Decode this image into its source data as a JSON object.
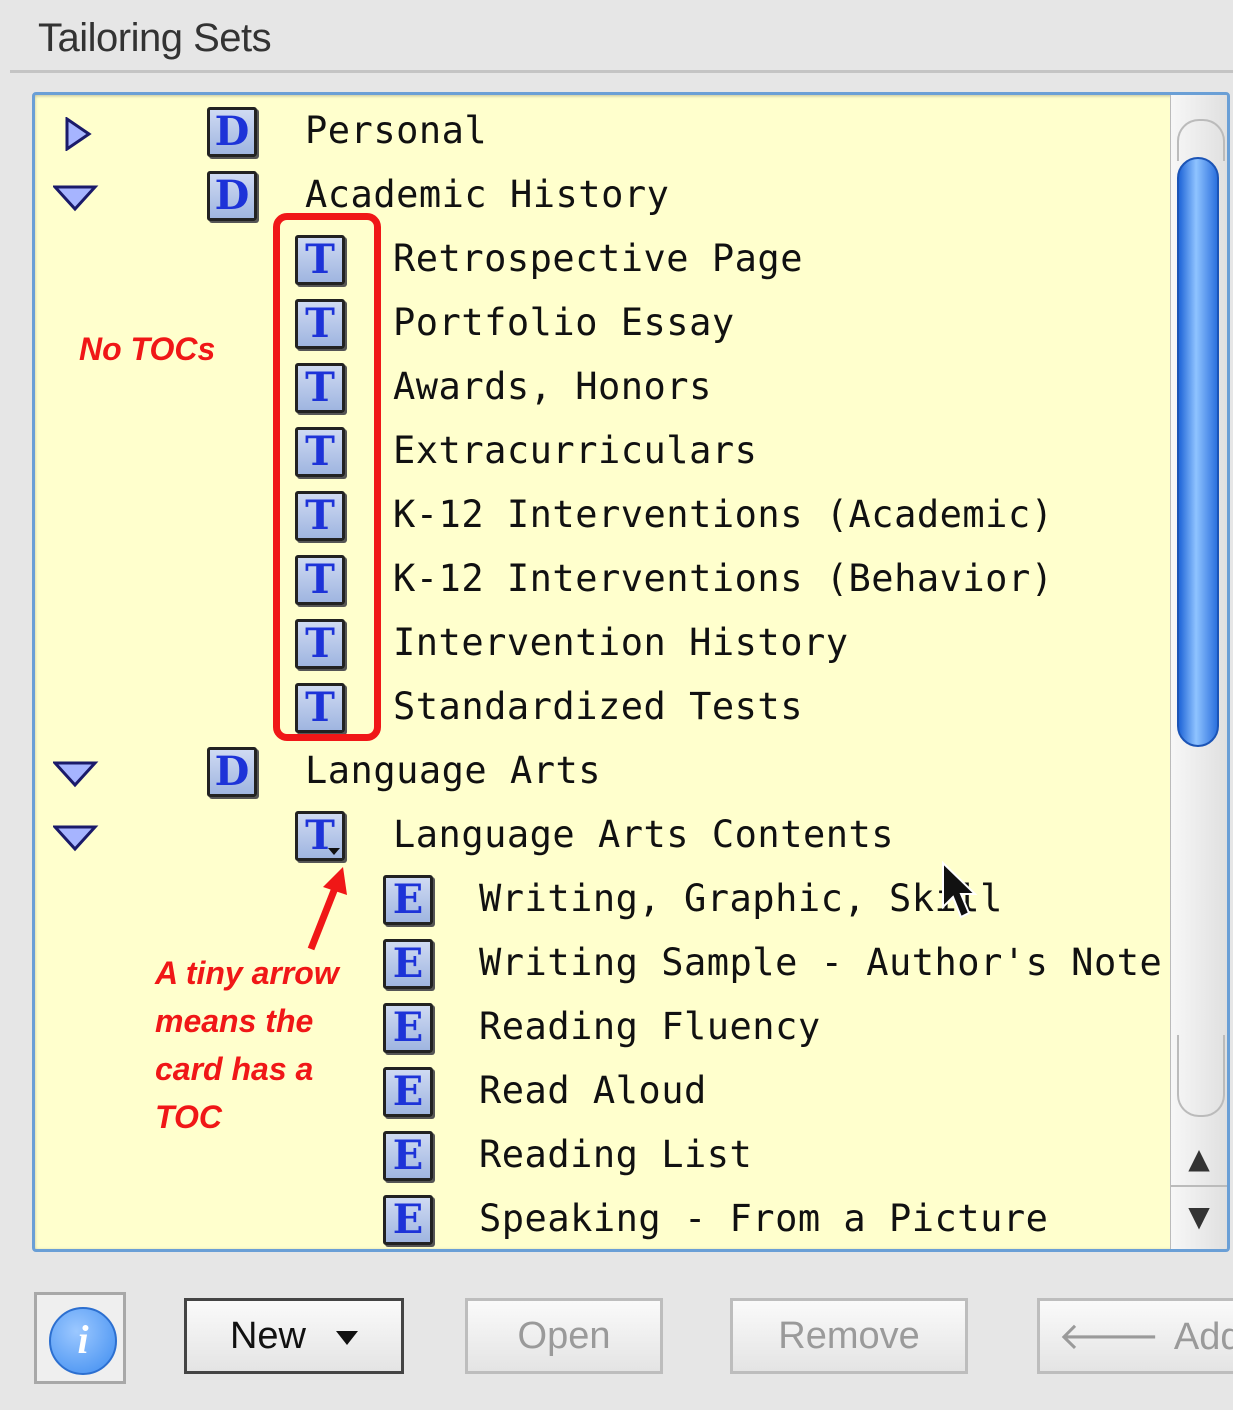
{
  "panel": {
    "title": "Tailoring Sets"
  },
  "tree": [
    {
      "label": "Personal",
      "badge": "D",
      "indent": 0,
      "disclosure": "collapsed"
    },
    {
      "label": "Academic History",
      "badge": "D",
      "indent": 0,
      "disclosure": "expanded"
    },
    {
      "label": "Retrospective Page",
      "badge": "T",
      "indent": 1
    },
    {
      "label": "Portfolio Essay",
      "badge": "T",
      "indent": 1
    },
    {
      "label": "Awards, Honors",
      "badge": "T",
      "indent": 1
    },
    {
      "label": "Extracurriculars",
      "badge": "T",
      "indent": 1
    },
    {
      "label": "K-12 Interventions (Academic)",
      "badge": "T",
      "indent": 1
    },
    {
      "label": "K-12 Interventions (Behavior)",
      "badge": "T",
      "indent": 1
    },
    {
      "label": "Intervention History",
      "badge": "T",
      "indent": 1
    },
    {
      "label": "Standardized Tests",
      "badge": "T",
      "indent": 1
    },
    {
      "label": "Language Arts",
      "badge": "D",
      "indent": 0,
      "disclosure": "expanded"
    },
    {
      "label": "Language Arts Contents",
      "badge": "T",
      "indent": 1,
      "disclosure": "expanded",
      "has_toc": true
    },
    {
      "label": "Writing, Graphic, Skill",
      "badge": "E",
      "indent": 2
    },
    {
      "label": "Writing Sample - Author's Note",
      "badge": "E",
      "indent": 2
    },
    {
      "label": "Reading Fluency",
      "badge": "E",
      "indent": 2
    },
    {
      "label": "Read Aloud",
      "badge": "E",
      "indent": 2
    },
    {
      "label": "Reading List",
      "badge": "E",
      "indent": 2
    },
    {
      "label": "Speaking - From a Picture",
      "badge": "E",
      "indent": 2
    }
  ],
  "annotations": {
    "no_tocs": "No TOCs",
    "tiny_arrow": [
      "A tiny arrow",
      "means the",
      "card has a",
      "TOC"
    ]
  },
  "scrollbar": {
    "up_glyph": "▲",
    "down_glyph": "▼"
  },
  "buttons": {
    "info": "i",
    "new": "New",
    "open": "Open",
    "remove": "Remove",
    "add": "Add",
    "add_arrow": "🡐"
  },
  "colors": {
    "list_bg": "#ffffcd",
    "badge_letter": "#1d33d8",
    "annotation": "#f01717"
  }
}
